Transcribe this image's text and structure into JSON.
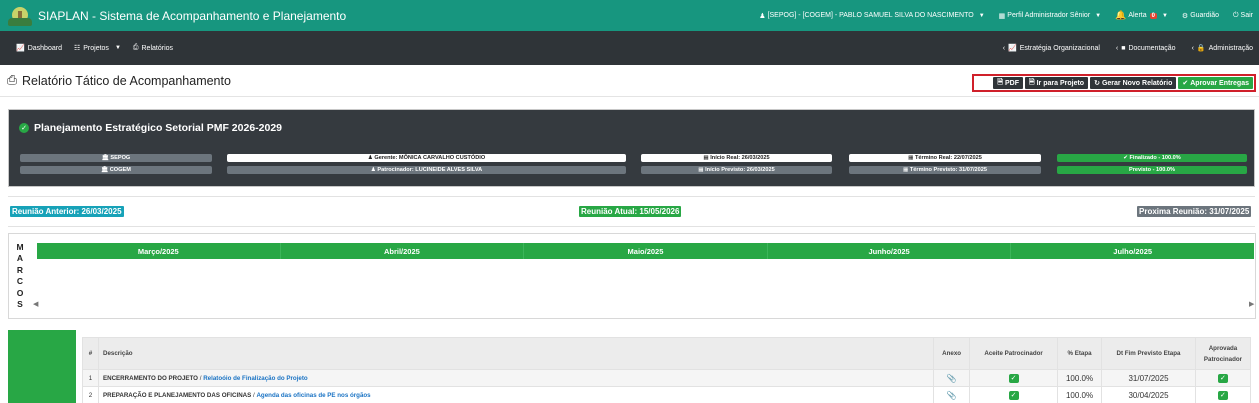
{
  "topbar": {
    "app_title": "SIAPLAN - Sistema de Acompanhamento e Planejamento",
    "user": "[SEPOG] - [COGEM] - PABLO SAMUEL SILVA DO NASCIMENTO",
    "profile": "Perfil Administrador Sênior",
    "alert_label": "Alerta",
    "alert_count": "0",
    "guardian": "Guardião",
    "logout": "Sair"
  },
  "nav": {
    "dashboard": "Dashboard",
    "projects": "Projetos",
    "reports": "Relatórios",
    "strategy": "Estratégia Organizacional",
    "docs": "Documentação",
    "admin": "Administração"
  },
  "page": {
    "title": "Relatório Tático de Acompanhamento"
  },
  "actions": {
    "pdf": "PDF",
    "go_project": "Ir para Projeto",
    "new_report": "Gerar Novo Relatório",
    "approve": "Aprovar Entregas"
  },
  "project": {
    "title": "Planejamento Estratégico Setorial PMF 2026-2029",
    "unit1": "SEPOG",
    "unit2": "COGEM",
    "manager": "Gerente: MÔNICA CARVALHO CUSTÓDIO",
    "sponsor": "Patrocinador: LUCINEIDE ALVES SILVA",
    "start_real": "Início Real: 26/03/2025",
    "start_planned": "Início Previsto: 26/03/2025",
    "end_real": "Término Real: 22/07/2025",
    "end_planned": "Término Previsto: 31/07/2025",
    "status": "Finalizado - 100.0%",
    "planned": "Previsto - 100.0%"
  },
  "meetings": {
    "previous": "Reunião Anterior: 26/03/2025",
    "current": "Reunião Atual: 15/05/2026",
    "next": "Proxima Reunião: 31/07/2025"
  },
  "marcos": {
    "label": [
      "M",
      "A",
      "R",
      "C",
      "O",
      "S"
    ],
    "months": [
      "Março/2025",
      "Abril/2025",
      "Maio/2025",
      "Junho/2025",
      "Julho/2025"
    ]
  },
  "table": {
    "headers": {
      "num": "#",
      "desc": "Descrição",
      "annex": "Anexo",
      "accept": "Aceite Patrocinador",
      "pct": "% Etapa",
      "date": "Dt Fim Previsto Etapa",
      "approved_1": "Aprovada",
      "approved_2": "Patrocinador"
    },
    "rows": [
      {
        "num": "1",
        "stage": "ENCERRAMENTO DO PROJETO",
        "deliverable": "Relatoóio de Finalização do Projeto",
        "pct": "100.0%",
        "date": "31/07/2025"
      },
      {
        "num": "2",
        "stage": "PREPARAÇÃO E PLANEJAMENTO DAS OFICINAS",
        "deliverable": "Agenda das oficinas de PE nos órgãos",
        "pct": "100.0%",
        "date": "30/04/2025"
      }
    ]
  },
  "colors": {
    "topbar": "#17967f",
    "navbar": "#2f3438",
    "green": "#28a745",
    "teal_badge": "#17a2b8",
    "grey_badge": "#6c757d",
    "highlight_border": "#d0202a"
  }
}
